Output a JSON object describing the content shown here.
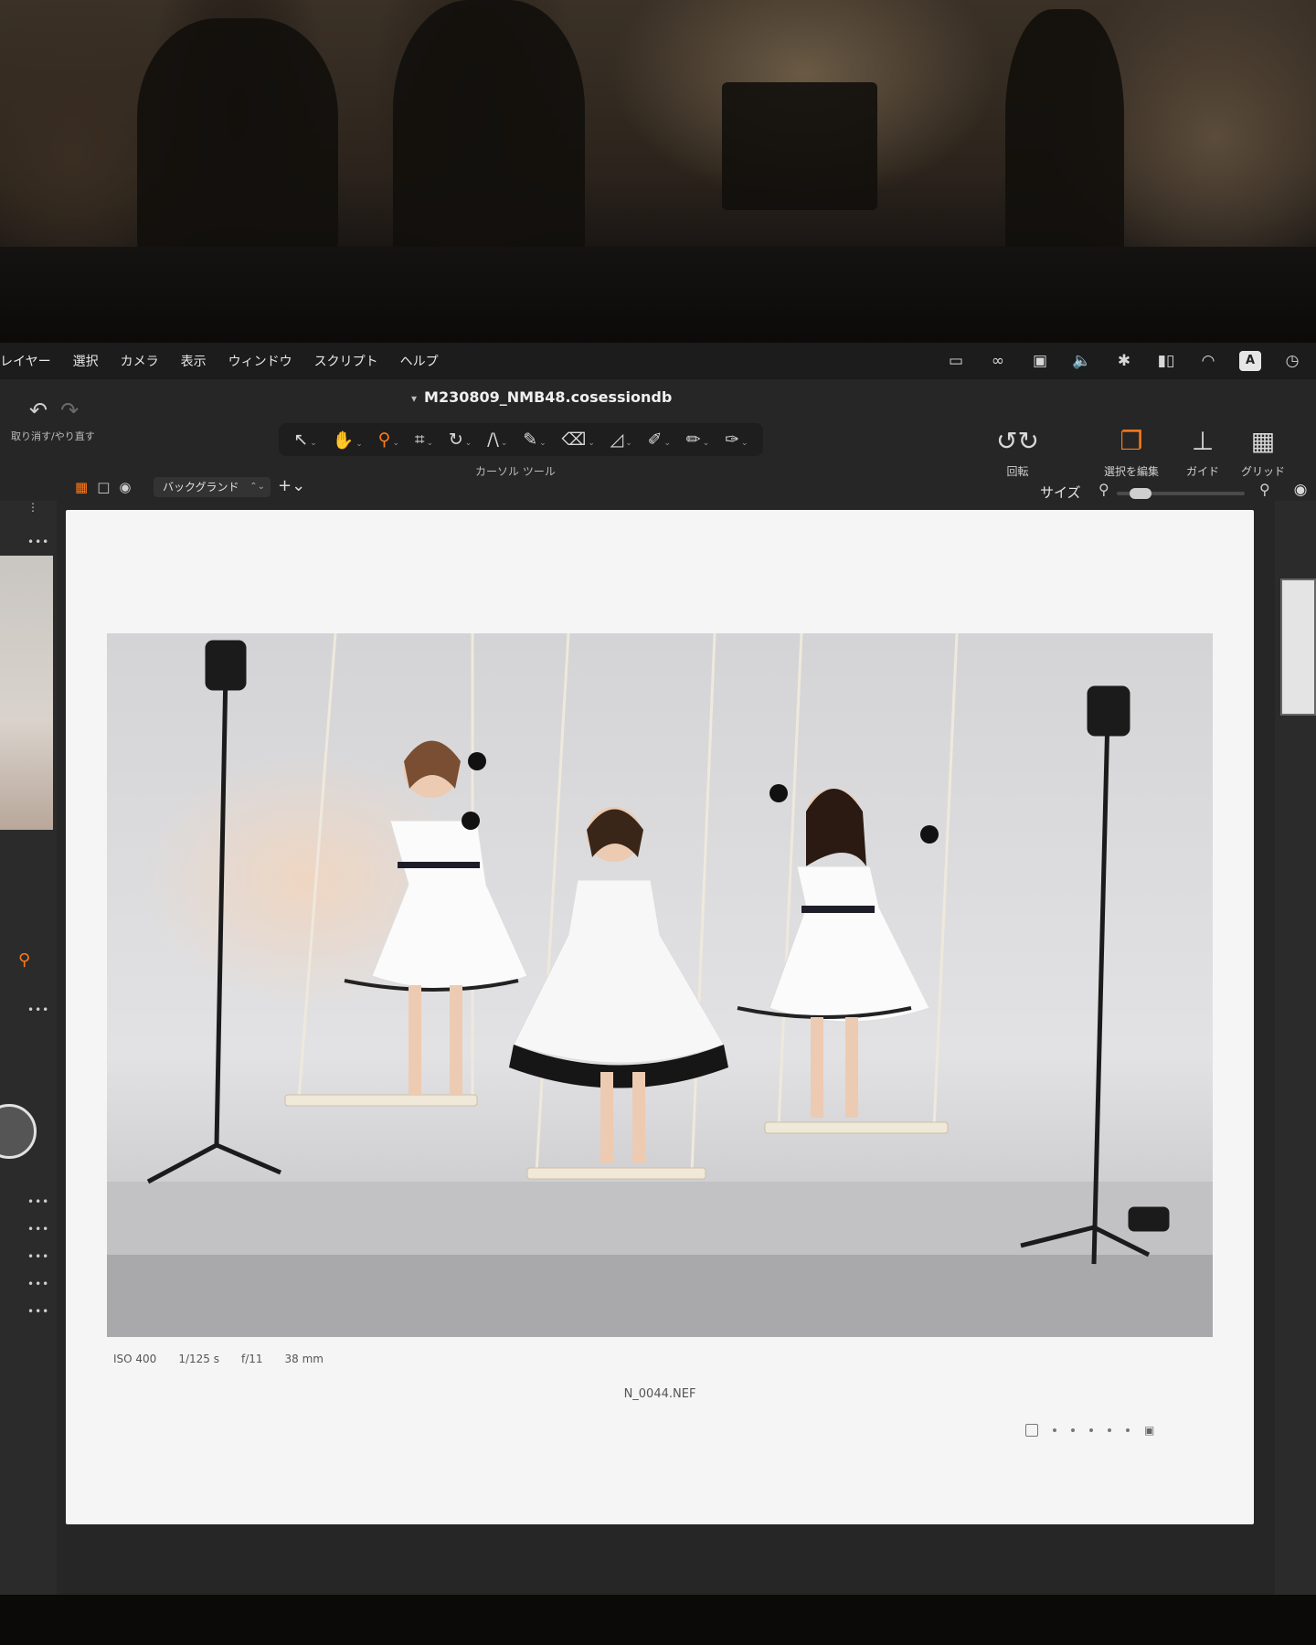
{
  "menubar": {
    "items": [
      "レイヤー",
      "選択",
      "カメラ",
      "表示",
      "ウィンドウ",
      "スクリプト",
      "ヘルプ"
    ],
    "status_icons": [
      "display-icon",
      "creative-cloud-icon",
      "screen-mirror-icon",
      "volume-icon",
      "bluetooth-icon",
      "battery-icon",
      "wifi-icon",
      "input-source-icon",
      "time-machine-icon"
    ],
    "input_source_label": "A"
  },
  "document": {
    "title": "M230809_NMB48.cosessiondb"
  },
  "toolbar": {
    "undo_label": "取り消す/やり直す",
    "cursor_tools_label": "カーソル ツール",
    "rotate_label": "回転",
    "edit_selection_label": "選択を編集",
    "guide_label": "ガイド",
    "grid_label": "グリッド"
  },
  "viewer": {
    "background_select_value": "バックグランド",
    "size_label": "サイズ"
  },
  "image": {
    "exif": {
      "iso": "ISO 400",
      "shutter": "1/125 s",
      "aperture": "f/11",
      "focal_length": "38 mm"
    },
    "filename": "N_0044.NEF"
  },
  "colors": {
    "accent": "#ff7a1a",
    "menubar_bg": "#1c1c1c",
    "app_bg": "#262626",
    "paper": "#f5f5f5"
  }
}
